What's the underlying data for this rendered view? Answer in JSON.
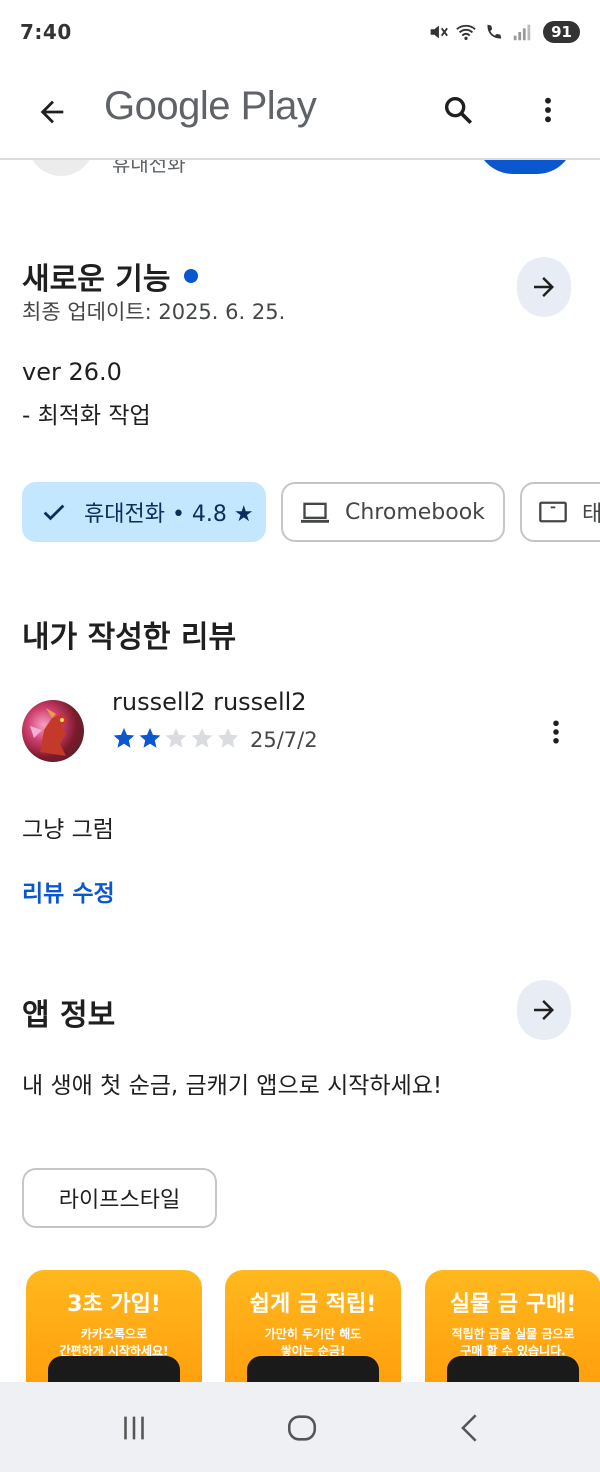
{
  "status_bar": {
    "time": "7:40",
    "battery": "91"
  },
  "app_bar": {
    "brand": "Google Play"
  },
  "peek": {
    "device_text": "휴대전화"
  },
  "whats_new": {
    "title": "새로운 기능",
    "updated": "최종 업데이트: 2025. 6. 25.",
    "version": "ver 26.0",
    "note": "- 최적화 작업"
  },
  "device_chips": [
    {
      "label": "휴대전화 • 4.8 ★",
      "selected": true
    },
    {
      "label": "Chromebook",
      "selected": false
    },
    {
      "label": "태",
      "selected": false
    }
  ],
  "my_review": {
    "title": "내가 작성한 리뷰",
    "author": "russell2 russell2",
    "rating": 2,
    "max_rating": 5,
    "date": "25/7/2",
    "text": "그냥 그럼",
    "edit_label": "리뷰 수정"
  },
  "app_info": {
    "title": "앱 정보",
    "description": "내 생애 첫 순금, 금캐기 앱으로 시작하세요!",
    "category": "라이프스타일"
  },
  "screenshots": [
    {
      "title": "3초 가입!",
      "sub1": "카카오톡으로",
      "sub2": "간편하게 시작하세요!"
    },
    {
      "title": "쉽게 금 적립!",
      "sub1": "가만히 두기만 해도",
      "sub2": "쌓이는 순금!"
    },
    {
      "title": "실물 금 구매!",
      "sub1": "적립한 금을 실물 금으로",
      "sub2": "구매 할 수 있습니다."
    }
  ],
  "colors": {
    "accent": "#0b57d0",
    "chip_selected": "#c2e7ff",
    "star_filled": "#0b57d0",
    "star_empty": "#dadce0"
  }
}
